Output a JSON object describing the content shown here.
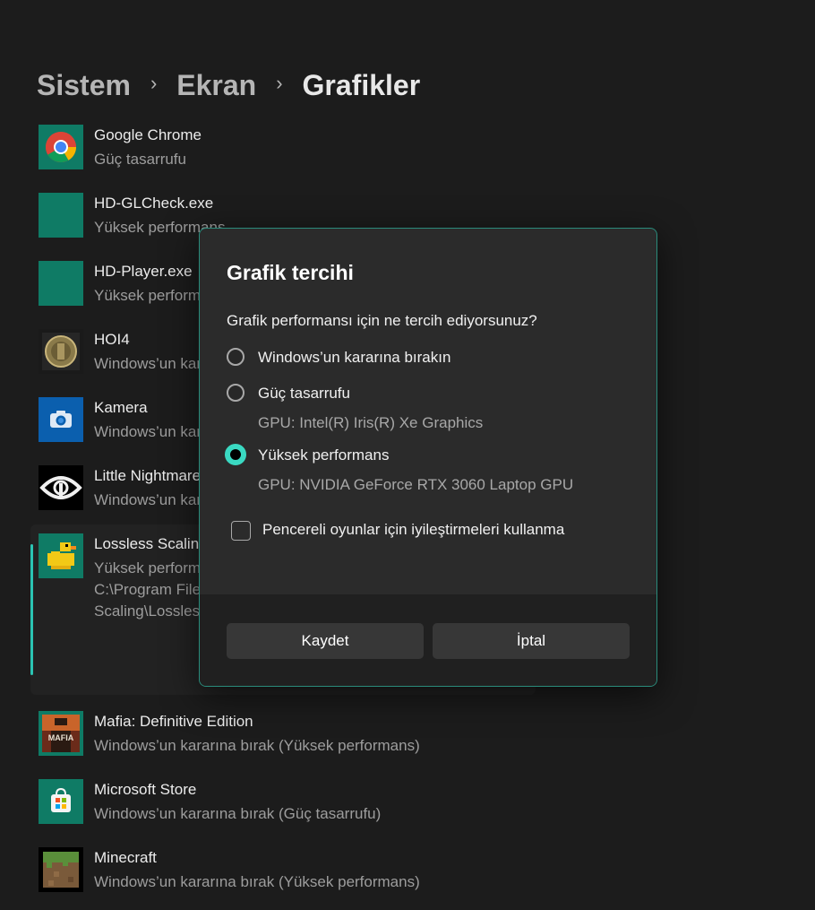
{
  "breadcrumb": {
    "items": [
      "Sistem",
      "Ekran",
      "Grafikler"
    ],
    "separator": "›"
  },
  "apps": [
    {
      "name": "Google Chrome",
      "sub": "Güç tasarrufu",
      "icon": "chrome-icon"
    },
    {
      "name": "HD-GLCheck.exe",
      "sub": "Yüksek performans",
      "icon": "generic-app-icon"
    },
    {
      "name": "HD-Player.exe",
      "sub": "Yüksek performans",
      "icon": "generic-app-icon"
    },
    {
      "name": "HOI4",
      "sub": "Windows’un kararına bırak",
      "icon": "hoi4-coin-icon"
    },
    {
      "name": "Kamera",
      "sub": "Windows’un kararına bırak",
      "icon": "camera-icon"
    },
    {
      "name": "Little Nightmares",
      "sub": "Windows’un kararına bırak",
      "icon": "eye-icon"
    },
    {
      "name": "Lossless Scaling",
      "sub": "Yüksek performans",
      "path_line1": "C:\\Program Files",
      "path_line2": "Scaling\\Lossless",
      "icon": "duck-icon"
    },
    {
      "name": "Mafia: Definitive Edition",
      "sub": "Windows’un kararına bırak (Yüksek performans)",
      "icon": "mafia-icon"
    },
    {
      "name": "Microsoft Store",
      "sub": "Windows’un kararına bırak (Güç tasarrufu)",
      "icon": "store-icon"
    },
    {
      "name": "Minecraft",
      "sub": "Windows’un kararına bırak (Yüksek performans)",
      "icon": "grass-block-icon"
    }
  ],
  "dialog": {
    "title": "Grafik tercihi",
    "question": "Grafik performansı için ne tercih ediyorsunuz?",
    "options": [
      {
        "label": "Windows’un kararına bırakın",
        "gpu": "",
        "selected": false
      },
      {
        "label": "Güç tasarrufu",
        "gpu": "GPU: Intel(R) Iris(R) Xe Graphics",
        "selected": false
      },
      {
        "label": "Yüksek performans",
        "gpu": "GPU: NVIDIA GeForce RTX 3060 Laptop GPU",
        "selected": true
      }
    ],
    "checkbox_label": "Pencereli oyunlar için iyileştirmeleri kullanma",
    "checkbox_checked": false,
    "save_label": "Kaydet",
    "cancel_label": "İptal"
  },
  "colors": {
    "accent": "#3ad9c2",
    "icon_bg": "#0f7b65",
    "background": "#1c1c1c",
    "dialog_bg": "#2b2b2b"
  }
}
